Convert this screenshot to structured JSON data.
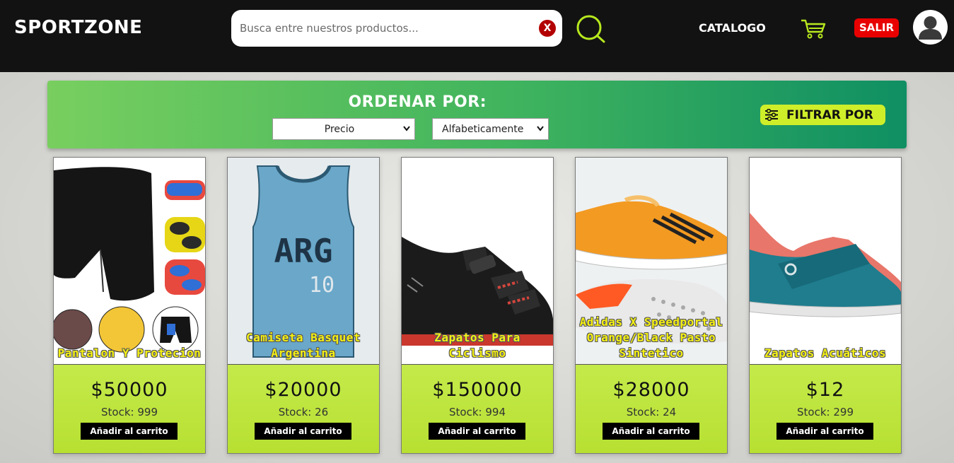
{
  "header": {
    "logo": "SPORTZONE",
    "search_placeholder": "Busca entre nuestros productos...",
    "search_value": "",
    "clear_label": "X",
    "catalog_label": "CATALOGO",
    "logout_label": "SALIR",
    "colors": {
      "background": "#121212",
      "accent": "#b7e81e",
      "logout": "#e80000"
    }
  },
  "sort_bar": {
    "title": "ORDENAR POR:",
    "price_select": "Precio",
    "alpha_select": "Alfabeticamente",
    "filter_label": "FILTRAR POR"
  },
  "products": [
    {
      "name": "Pantalon Y Protecion",
      "price": "$50000",
      "stock": "Stock: 999",
      "add_label": "Añadir al carrito",
      "icon": "cycling-shorts-image"
    },
    {
      "name": "Camiseta Basquet Argentina",
      "price": "$20000",
      "stock": "Stock: 26",
      "add_label": "Añadir al carrito",
      "icon": "basketball-jersey-image",
      "jersey_text": "ARG",
      "jersey_number": "10"
    },
    {
      "name": "Zapatos Para Ciclismo",
      "price": "$150000",
      "stock": "Stock: 994",
      "add_label": "Añadir al carrito",
      "icon": "cycling-shoe-image"
    },
    {
      "name": "Adidas X Speedportal Orange/Black Pasto Sintetico",
      "price": "$28000",
      "stock": "Stock: 24",
      "add_label": "Añadir al carrito",
      "icon": "soccer-cleat-image"
    },
    {
      "name": "Zapatos Acuáticos",
      "price": "$12",
      "stock": "Stock: 299",
      "add_label": "Añadir al carrito",
      "icon": "water-shoe-image"
    }
  ]
}
